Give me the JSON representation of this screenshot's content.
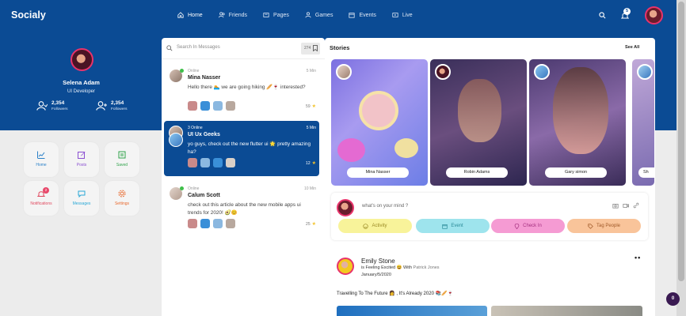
{
  "brand": "Socialy",
  "nav": [
    {
      "label": "Home",
      "icon": "home-icon",
      "active": true
    },
    {
      "label": "Friends",
      "icon": "friends-icon"
    },
    {
      "label": "Pages",
      "icon": "pages-icon"
    },
    {
      "label": "Games",
      "icon": "games-icon"
    },
    {
      "label": "Events",
      "icon": "events-icon"
    },
    {
      "label": "Live",
      "icon": "live-icon"
    }
  ],
  "notifications_badge": "5",
  "profile": {
    "name": "Selena Adam",
    "role": "UI Developer",
    "followers_a": {
      "count": "2,354",
      "label": "Followers"
    },
    "followers_b": {
      "count": "2,354",
      "label": "Followers"
    }
  },
  "tiles": [
    {
      "label": "Home",
      "icon": "home-chart-icon",
      "color": "#2a80c8"
    },
    {
      "label": "Posts",
      "icon": "edit-icon",
      "color": "#8a4fd1"
    },
    {
      "label": "Saved",
      "icon": "bookmark-icon",
      "color": "#2fa24a"
    },
    {
      "label": "Notifications",
      "icon": "bell-icon",
      "color": "#e0485e",
      "badge": "2"
    },
    {
      "label": "Messages",
      "icon": "chat-icon",
      "color": "#2aa8d6"
    },
    {
      "label": "Settings",
      "icon": "gear-icon",
      "color": "#e86a2f"
    }
  ],
  "messages": {
    "search_placeholder": "Search In Messages",
    "count": "274",
    "conversations": [
      {
        "status": "Online",
        "time": "5 Min",
        "name": "Mina Nasser",
        "text": "Hello there 🏊 we are going hiking 🥖🍷 interested?",
        "reads": "59"
      },
      {
        "status": "3 Online",
        "time": "5 Min",
        "name": "UI Ux Geeks",
        "text": "yo guys, check out the new flutter ui 🌟 pretty amazing ha?",
        "reads": "12"
      },
      {
        "status": "Online",
        "time": "10 Min",
        "name": "Calum Scott",
        "text": "check out this article about the new mobile apps ui trends for 2020! 🥑😊",
        "reads": "25"
      }
    ]
  },
  "stories": {
    "title": "Stories",
    "see_all": "See All",
    "items": [
      {
        "name": "Mina Nasser"
      },
      {
        "name": "Robin Adams"
      },
      {
        "name": "Gary simon"
      },
      {
        "name": "Sh"
      }
    ]
  },
  "compose": {
    "placeholder": "what's on your mind ?",
    "actions": [
      {
        "label": "Activity",
        "icon": "smile-icon",
        "bg": "#f8f39a",
        "fg": "#9a8a25"
      },
      {
        "label": "Event",
        "icon": "calendar-icon",
        "bg": "#9ee4ed",
        "fg": "#2a8a98"
      },
      {
        "label": "Check In",
        "icon": "location-icon",
        "bg": "#f59bd3",
        "fg": "#a4307f"
      },
      {
        "label": "Tag People",
        "icon": "tag-icon",
        "bg": "#f9c49a",
        "fg": "#a05a2a"
      }
    ]
  },
  "post": {
    "author": "Emily Stone",
    "feeling": "is Feeling Excited 😆 With",
    "with_name": "Patrick Jones",
    "date": "January/5/2020",
    "text": "Travelling To The Future 👩 , It's Already 2020 📚🥖🍷",
    "menu": "••"
  },
  "fab_label": "0"
}
